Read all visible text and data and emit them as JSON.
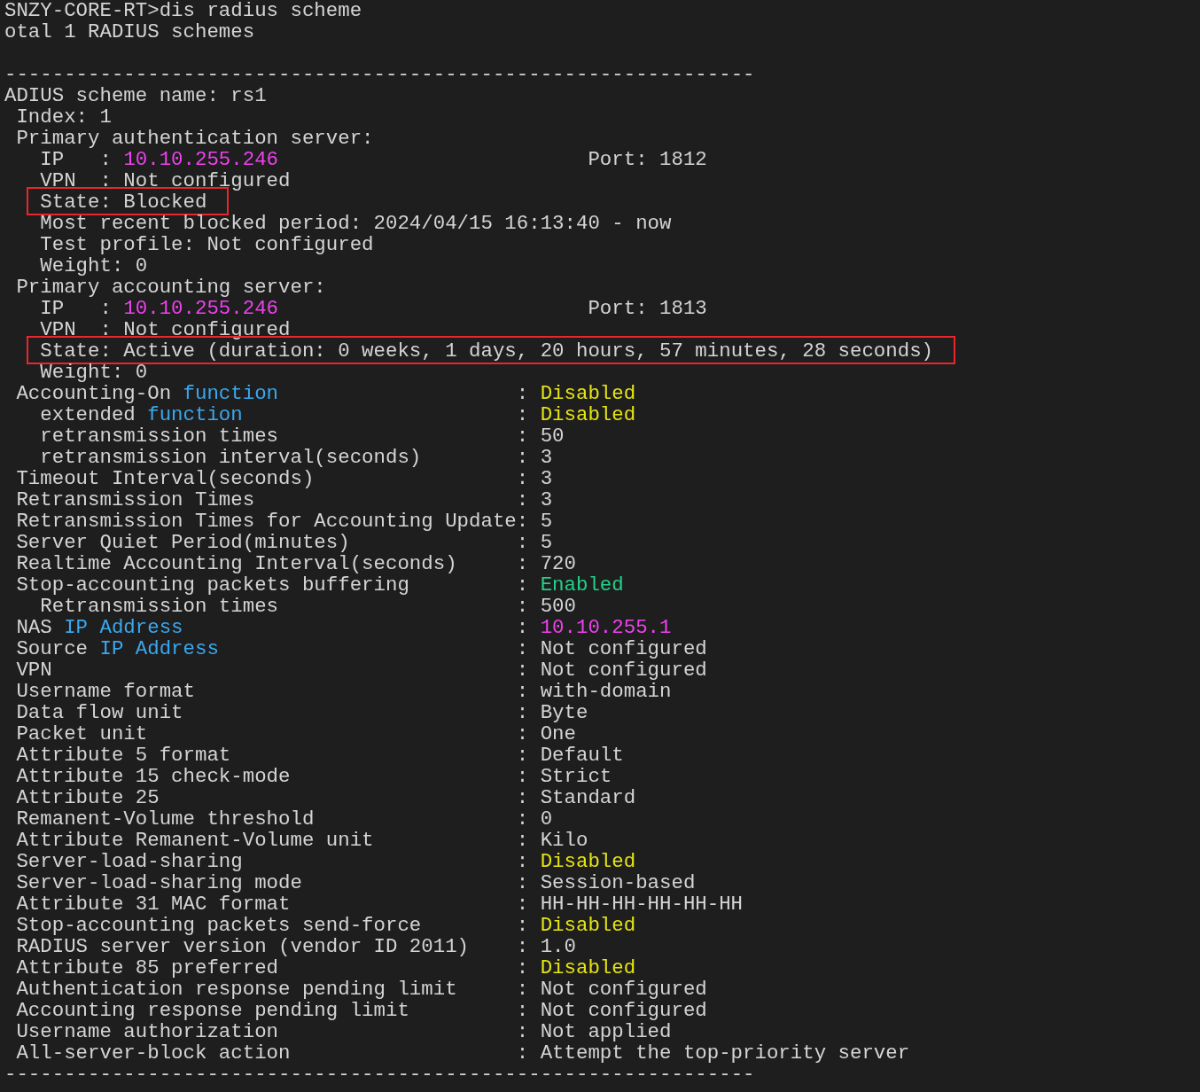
{
  "terminal": {
    "lines": [
      {
        "kind": "text",
        "boxed": false,
        "segments": [
          {
            "text": "SNZY-CORE-RT>dis radius scheme"
          }
        ]
      },
      {
        "kind": "text",
        "boxed": false,
        "segments": [
          {
            "text": "otal 1 RADIUS schemes"
          }
        ]
      },
      {
        "kind": "blank"
      },
      {
        "kind": "text",
        "boxed": false,
        "segments": [
          {
            "text": "---------------------------------------------------------------"
          }
        ]
      },
      {
        "kind": "text",
        "boxed": false,
        "segments": [
          {
            "text": "ADIUS scheme name: rs1"
          }
        ]
      },
      {
        "kind": "text",
        "boxed": false,
        "segments": [
          {
            "text": " Index: 1"
          }
        ]
      },
      {
        "kind": "text",
        "boxed": false,
        "segments": [
          {
            "text": " Primary authentication server:"
          }
        ]
      },
      {
        "kind": "text",
        "boxed": false,
        "segments": [
          {
            "text": "   IP   : "
          },
          {
            "text": "10.10.255.246",
            "color": "#f040f0"
          },
          {
            "text": "                          Port: 1812"
          }
        ]
      },
      {
        "kind": "text",
        "boxed": false,
        "segments": [
          {
            "text": "   VPN  : Not configured"
          }
        ]
      },
      {
        "kind": "text",
        "boxed": true,
        "segments": [
          {
            "text": "   State: Blocked"
          }
        ]
      },
      {
        "kind": "text",
        "boxed": false,
        "segments": [
          {
            "text": "   Most recent blocked period: 2024/04/15 16:13:40 - now"
          }
        ]
      },
      {
        "kind": "text",
        "boxed": false,
        "segments": [
          {
            "text": "   Test profile: Not configured"
          }
        ]
      },
      {
        "kind": "text",
        "boxed": false,
        "segments": [
          {
            "text": "   Weight: 0"
          }
        ]
      },
      {
        "kind": "text",
        "boxed": false,
        "segments": [
          {
            "text": " Primary accounting server:"
          }
        ]
      },
      {
        "kind": "text",
        "boxed": false,
        "segments": [
          {
            "text": "   IP   : "
          },
          {
            "text": "10.10.255.246",
            "color": "#f040f0"
          },
          {
            "text": "                          Port: 1813"
          }
        ]
      },
      {
        "kind": "text",
        "boxed": false,
        "segments": [
          {
            "text": "   VPN  : Not configured"
          }
        ]
      },
      {
        "kind": "text",
        "boxed": true,
        "segments": [
          {
            "text": "   State: Active (duration: 0 weeks, 1 days, 20 hours, 57 minutes, 28 seconds)"
          }
        ]
      },
      {
        "kind": "text",
        "boxed": false,
        "segments": [
          {
            "text": "   Weight: 0"
          }
        ]
      },
      {
        "kind": "kv",
        "key": [
          {
            "text": " Accounting-On "
          },
          {
            "text": "function",
            "color": "#3aa8f0"
          }
        ],
        "value": [
          {
            "text": ": "
          },
          {
            "text": "Disabled",
            "color": "#e5e510"
          }
        ]
      },
      {
        "kind": "kv",
        "key": [
          {
            "text": "   extended "
          },
          {
            "text": "function",
            "color": "#3aa8f0"
          }
        ],
        "value": [
          {
            "text": ": "
          },
          {
            "text": "Disabled",
            "color": "#e5e510"
          }
        ]
      },
      {
        "kind": "kv",
        "key": [
          {
            "text": "   retransmission times"
          }
        ],
        "value": [
          {
            "text": ": 50"
          }
        ]
      },
      {
        "kind": "kv",
        "key": [
          {
            "text": "   retransmission interval(seconds)"
          }
        ],
        "value": [
          {
            "text": ": 3"
          }
        ]
      },
      {
        "kind": "kv",
        "key": [
          {
            "text": " Timeout Interval(seconds)"
          }
        ],
        "value": [
          {
            "text": ": 3"
          }
        ]
      },
      {
        "kind": "kv",
        "key": [
          {
            "text": " Retransmission Times"
          }
        ],
        "value": [
          {
            "text": ": 3"
          }
        ]
      },
      {
        "kind": "kv",
        "key": [
          {
            "text": " Retransmission Times for Accounting Update"
          }
        ],
        "value": [
          {
            "text": ": 5"
          }
        ]
      },
      {
        "kind": "kv",
        "key": [
          {
            "text": " Server Quiet Period(minutes)"
          }
        ],
        "value": [
          {
            "text": ": 5"
          }
        ]
      },
      {
        "kind": "kv",
        "key": [
          {
            "text": " Realtime Accounting Interval(seconds)"
          }
        ],
        "value": [
          {
            "text": ": 720"
          }
        ]
      },
      {
        "kind": "kv",
        "key": [
          {
            "text": " Stop-accounting packets buffering"
          }
        ],
        "value": [
          {
            "text": ": "
          },
          {
            "text": "Enabled",
            "color": "#23d18b"
          }
        ]
      },
      {
        "kind": "kv",
        "key": [
          {
            "text": "   Retransmission times"
          }
        ],
        "value": [
          {
            "text": ": 500"
          }
        ]
      },
      {
        "kind": "kv",
        "key": [
          {
            "text": " NAS "
          },
          {
            "text": "IP Address",
            "color": "#3aa8f0"
          }
        ],
        "value": [
          {
            "text": ": "
          },
          {
            "text": "10.10.255.1",
            "color": "#f040f0"
          }
        ]
      },
      {
        "kind": "kv",
        "key": [
          {
            "text": " Source "
          },
          {
            "text": "IP Address",
            "color": "#3aa8f0"
          }
        ],
        "value": [
          {
            "text": ": Not configured"
          }
        ]
      },
      {
        "kind": "kv",
        "key": [
          {
            "text": " VPN"
          }
        ],
        "value": [
          {
            "text": ": Not configured"
          }
        ]
      },
      {
        "kind": "kv",
        "key": [
          {
            "text": " Username format"
          }
        ],
        "value": [
          {
            "text": ": with-domain"
          }
        ]
      },
      {
        "kind": "kv",
        "key": [
          {
            "text": " Data flow unit"
          }
        ],
        "value": [
          {
            "text": ": Byte"
          }
        ]
      },
      {
        "kind": "kv",
        "key": [
          {
            "text": " Packet unit"
          }
        ],
        "value": [
          {
            "text": ": One"
          }
        ]
      },
      {
        "kind": "kv",
        "key": [
          {
            "text": " Attribute 5 format"
          }
        ],
        "value": [
          {
            "text": ": Default"
          }
        ]
      },
      {
        "kind": "kv",
        "key": [
          {
            "text": " Attribute 15 check-mode"
          }
        ],
        "value": [
          {
            "text": ": Strict"
          }
        ]
      },
      {
        "kind": "kv",
        "key": [
          {
            "text": " Attribute 25"
          }
        ],
        "value": [
          {
            "text": ": Standard"
          }
        ]
      },
      {
        "kind": "kv",
        "key": [
          {
            "text": " Remanent-Volume threshold"
          }
        ],
        "value": [
          {
            "text": ": 0"
          }
        ]
      },
      {
        "kind": "kv",
        "key": [
          {
            "text": " Attribute Remanent-Volume unit"
          }
        ],
        "value": [
          {
            "text": ": Kilo"
          }
        ]
      },
      {
        "kind": "kv",
        "key": [
          {
            "text": " Server-load-sharing"
          }
        ],
        "value": [
          {
            "text": ": "
          },
          {
            "text": "Disabled",
            "color": "#e5e510"
          }
        ]
      },
      {
        "kind": "kv",
        "key": [
          {
            "text": " Server-load-sharing mode"
          }
        ],
        "value": [
          {
            "text": ": Session-based"
          }
        ]
      },
      {
        "kind": "kv",
        "key": [
          {
            "text": " Attribute 31 MAC format"
          }
        ],
        "value": [
          {
            "text": ": HH-HH-HH-HH-HH-HH"
          }
        ]
      },
      {
        "kind": "kv",
        "key": [
          {
            "text": " Stop-accounting packets send-force"
          }
        ],
        "value": [
          {
            "text": ": "
          },
          {
            "text": "Disabled",
            "color": "#e5e510"
          }
        ]
      },
      {
        "kind": "kv",
        "key": [
          {
            "text": " RADIUS server version (vendor ID 2011)"
          }
        ],
        "value": [
          {
            "text": ": 1.0"
          }
        ]
      },
      {
        "kind": "kv",
        "key": [
          {
            "text": " Attribute 85 preferred"
          }
        ],
        "value": [
          {
            "text": ": "
          },
          {
            "text": "Disabled",
            "color": "#e5e510"
          }
        ]
      },
      {
        "kind": "kv",
        "key": [
          {
            "text": " Authentication response pending limit"
          }
        ],
        "value": [
          {
            "text": ": Not configured"
          }
        ]
      },
      {
        "kind": "kv",
        "key": [
          {
            "text": " Accounting response pending limit"
          }
        ],
        "value": [
          {
            "text": ": Not configured"
          }
        ]
      },
      {
        "kind": "kv",
        "key": [
          {
            "text": " Username authorization"
          }
        ],
        "value": [
          {
            "text": ": Not applied"
          }
        ]
      },
      {
        "kind": "kv",
        "key": [
          {
            "text": " All-server-block action"
          }
        ],
        "value": [
          {
            "text": ": Attempt the top-priority server"
          }
        ]
      },
      {
        "kind": "text",
        "boxed": false,
        "segments": [
          {
            "text": "---------------------------------------------------------------"
          }
        ]
      }
    ]
  }
}
